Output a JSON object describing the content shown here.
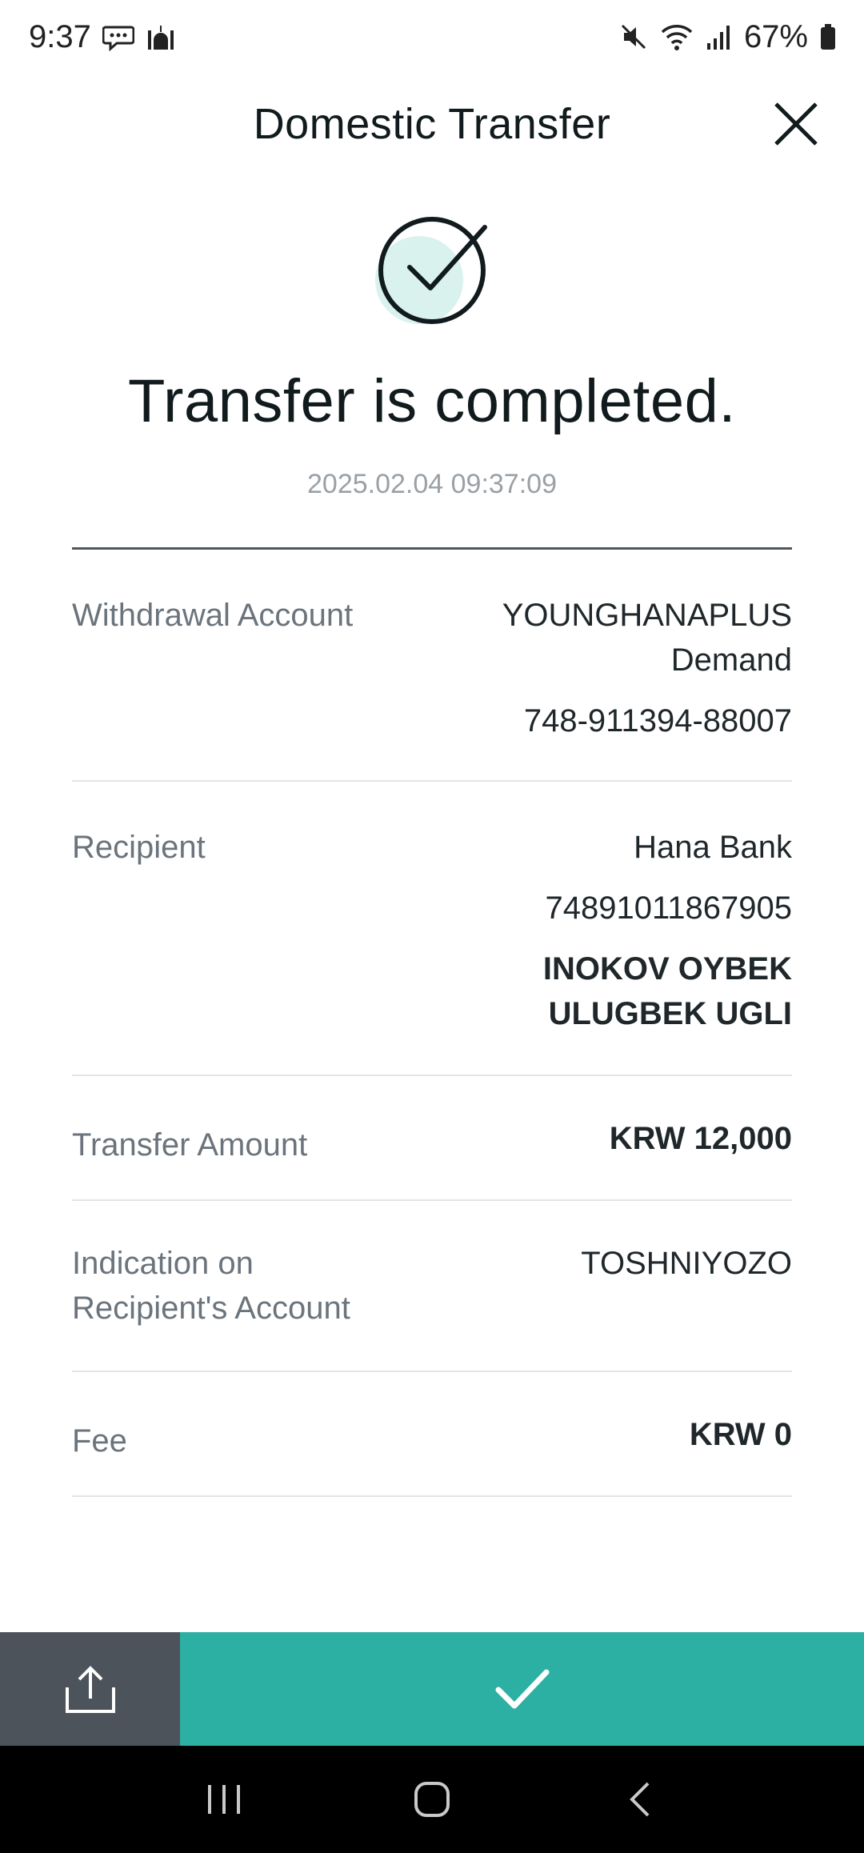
{
  "status_bar": {
    "time": "9:37",
    "battery": "67%",
    "left_icons": [
      "chat-icon",
      "mosque-icon"
    ],
    "right_icons": [
      "mute-icon",
      "wifi-icon",
      "signal-icon",
      "battery-icon"
    ]
  },
  "header": {
    "title": "Domestic Transfer",
    "close_icon": "close-icon"
  },
  "result": {
    "icon": "check-circle-icon",
    "title": "Transfer is completed.",
    "timestamp": "2025.02.04 09:37:09"
  },
  "details": {
    "withdrawal": {
      "label": "Withdrawal Account",
      "name_line1": "YOUNGHANAPLUS",
      "name_line2": "Demand",
      "number": "748-911394-88007"
    },
    "recipient": {
      "label": "Recipient",
      "bank": "Hana Bank",
      "account": "74891011867905",
      "name_line1": "INOKOV OYBEK",
      "name_line2": "ULUGBEK UGLI"
    },
    "amount": {
      "label": "Transfer Amount",
      "value": "KRW 12,000"
    },
    "indication": {
      "label_line1": "Indication on",
      "label_line2": "Recipient's Account",
      "value": "TOSHNIYOZO"
    },
    "fee": {
      "label": "Fee",
      "value": "KRW 0"
    }
  },
  "actions": {
    "share_icon": "share-icon",
    "confirm_icon": "checkmark-icon"
  },
  "nav": {
    "recents_icon": "recents-icon",
    "home_icon": "home-icon",
    "back_icon": "back-icon"
  },
  "colors": {
    "accent": "#2bb0a3",
    "share_bg": "#4d535b",
    "check_fill": "#d9f2ee",
    "divider_dark": "#4f5861",
    "label_gray": "#6b747c"
  }
}
